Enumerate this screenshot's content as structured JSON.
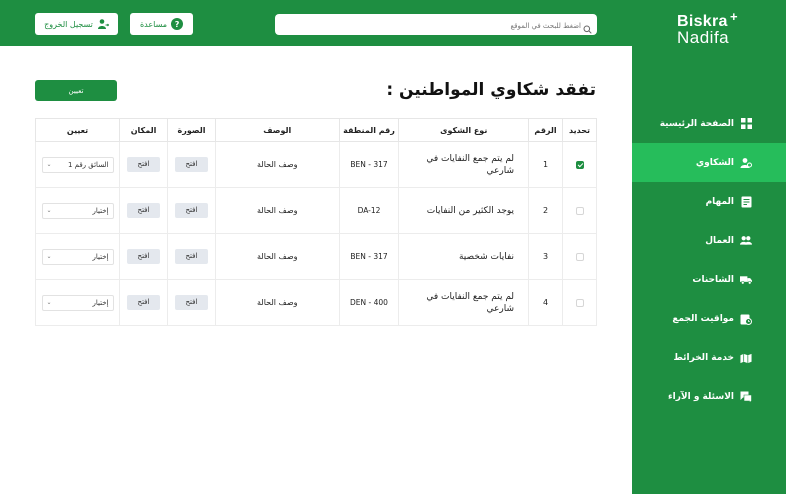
{
  "header": {
    "logout_label": "تسجيل الخروج",
    "help_label": "مساعدة",
    "help_icon_glyph": "?",
    "search_placeholder": "اضغط للبحث في الموقع"
  },
  "logo": {
    "line1": "Biskra",
    "line2": "Nadifa",
    "plus": "+"
  },
  "sidebar": {
    "items": [
      {
        "label": "الصفحة الرئيسية",
        "icon": "grid-icon",
        "active": false
      },
      {
        "label": "الشكاوي",
        "icon": "users-complaint-icon",
        "active": true
      },
      {
        "label": "المهام",
        "icon": "tasks-icon",
        "active": false
      },
      {
        "label": "العمال",
        "icon": "workers-icon",
        "active": false
      },
      {
        "label": "الشاحنات",
        "icon": "truck-icon",
        "active": false
      },
      {
        "label": "مواقيت الجمع",
        "icon": "clock-icon",
        "active": false
      },
      {
        "label": "خدمة الخرائط",
        "icon": "map-icon",
        "active": false
      },
      {
        "label": "الاسئلة و الآراء",
        "icon": "question-chat-icon",
        "active": false
      }
    ]
  },
  "main": {
    "title": "تفقد شكاوي المواطنين :",
    "assign_button": "تعيين",
    "columns": [
      "تحديد",
      "الرقم",
      "نوع الشكوى",
      "رقم المنطقة",
      "الوصف",
      "الصورة",
      "المكان",
      "تعيين"
    ],
    "rows": [
      {
        "checked": true,
        "num": "1",
        "type": "لم يتم جمع النفايات في شارعي",
        "region": "317 - BEN",
        "desc": "وصف الحالة",
        "image": "افتح",
        "place": "افتح",
        "assign": "السائق رقم 1"
      },
      {
        "checked": false,
        "num": "2",
        "type": "يوجد الكثير من النفايات",
        "region": "DA-12",
        "desc": "وصف الحالة",
        "image": "افتح",
        "place": "افتح",
        "assign": "إختيار"
      },
      {
        "checked": false,
        "num": "3",
        "type": "نفايات شخصية",
        "region": "317 - BEN",
        "desc": "وصف الحالة",
        "image": "افتح",
        "place": "افتح",
        "assign": "إختيار"
      },
      {
        "checked": false,
        "num": "4",
        "type": "لم يتم جمع النفايات في شارعي",
        "region": "400 - DEN",
        "desc": "وصف الحالة",
        "image": "افتح",
        "place": "افتح",
        "assign": "إختيار"
      }
    ]
  },
  "colors": {
    "primary": "#1e8e41",
    "active": "#26bd5b"
  }
}
